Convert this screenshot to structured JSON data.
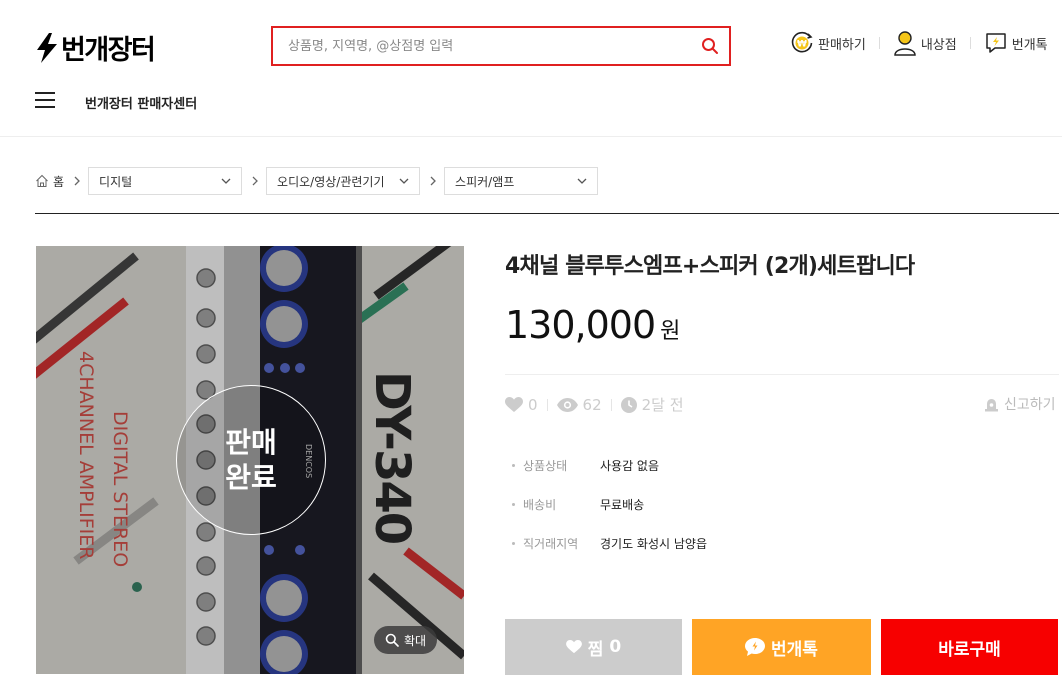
{
  "header": {
    "logo_text": "번개장터",
    "search_placeholder": "상품명, 지역명, @상점명 입력",
    "nav": [
      {
        "label": "판매하기",
        "icon": "sell-won-icon"
      },
      {
        "label": "내상점",
        "icon": "user-icon"
      },
      {
        "label": "번개톡",
        "icon": "chat-icon"
      }
    ],
    "seller_center": "번개장터 판매자센터"
  },
  "breadcrumb": {
    "home": "홈",
    "categories": [
      "디지털",
      "오디오/영상/관련기기",
      "스피커/앰프"
    ]
  },
  "product": {
    "image_overlay_line1": "판매",
    "image_overlay_line2": "완료",
    "image_text_model": "DY-340",
    "image_text_line1": "DIGITAL STEREO",
    "image_text_line2": "4CHANNEL AMPLIFIER",
    "image_text_brand": "DENCOS",
    "zoom_label": "확대",
    "title": "4채널 블루투스엠프+스피커 (2개)세트팝니다",
    "price": "130,000",
    "price_unit": "원",
    "likes": "0",
    "views": "62",
    "time": "2달 전",
    "report_label": "신고하기",
    "details": [
      {
        "label": "상품상태",
        "value": "사용감 없음"
      },
      {
        "label": "배송비",
        "value": "무료배송"
      },
      {
        "label": "직거래지역",
        "value": "경기도 화성시 남양읍"
      }
    ]
  },
  "actions": {
    "wish_label": "찜",
    "wish_count": "0",
    "talk_label": "번개톡",
    "buy_label": "바로구매"
  },
  "colors": {
    "accent_red": "#e02020",
    "buy_red": "#f70000",
    "talk_orange": "#ffa425",
    "wish_gray": "#cccccc"
  }
}
